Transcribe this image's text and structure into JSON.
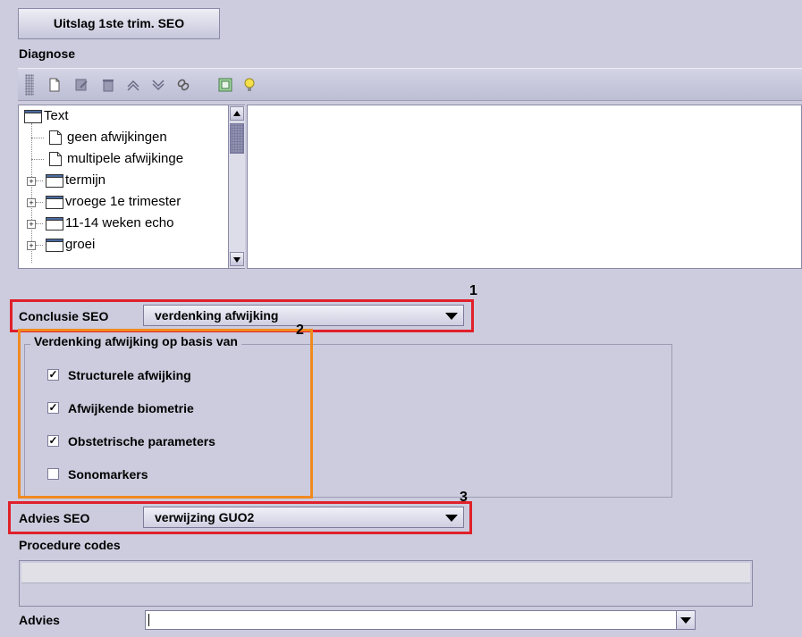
{
  "header": {
    "top_button_label": "Uitslag 1ste trim. SEO"
  },
  "diagnose": {
    "label": "Diagnose",
    "toolbar_icons": [
      "new-document-icon",
      "edit-icon",
      "trash-icon",
      "move-up-icon",
      "move-down-icon",
      "link-icon",
      "calculator-icon",
      "lightbulb-icon"
    ],
    "tree": {
      "root": "Text",
      "items": [
        {
          "label": "geen afwijkingen",
          "type": "document"
        },
        {
          "label": "multipele afwijkinge",
          "type": "document"
        },
        {
          "label": "termijn",
          "type": "folder"
        },
        {
          "label": "vroege 1e trimester",
          "type": "folder"
        },
        {
          "label": "11-14 weken echo",
          "type": "folder"
        },
        {
          "label": "groei",
          "type": "folder"
        }
      ]
    }
  },
  "conclusie": {
    "label": "Conclusie SEO",
    "value": "verdenking afwijking",
    "marker": "1"
  },
  "verdenking": {
    "title": "Verdenking afwijking op basis van",
    "marker": "2",
    "checkboxes": [
      {
        "label": "Structurele afwijking",
        "checked": true,
        "mark": "✓"
      },
      {
        "label": "Afwijkende biometrie",
        "checked": true,
        "mark": "✓"
      },
      {
        "label": "Obstetrische parameters",
        "checked": true,
        "mark": "✓"
      },
      {
        "label": "Sonomarkers",
        "checked": false,
        "mark": ""
      }
    ]
  },
  "advies_seo": {
    "label": "Advies SEO",
    "value": "verwijzing GUO2",
    "marker": "3"
  },
  "procedure": {
    "label": "Procedure codes"
  },
  "advies": {
    "label": "Advies",
    "value": ""
  },
  "colors": {
    "background": "#ccccde",
    "highlight_red": "#e0202a",
    "highlight_orange": "#f08a20"
  }
}
